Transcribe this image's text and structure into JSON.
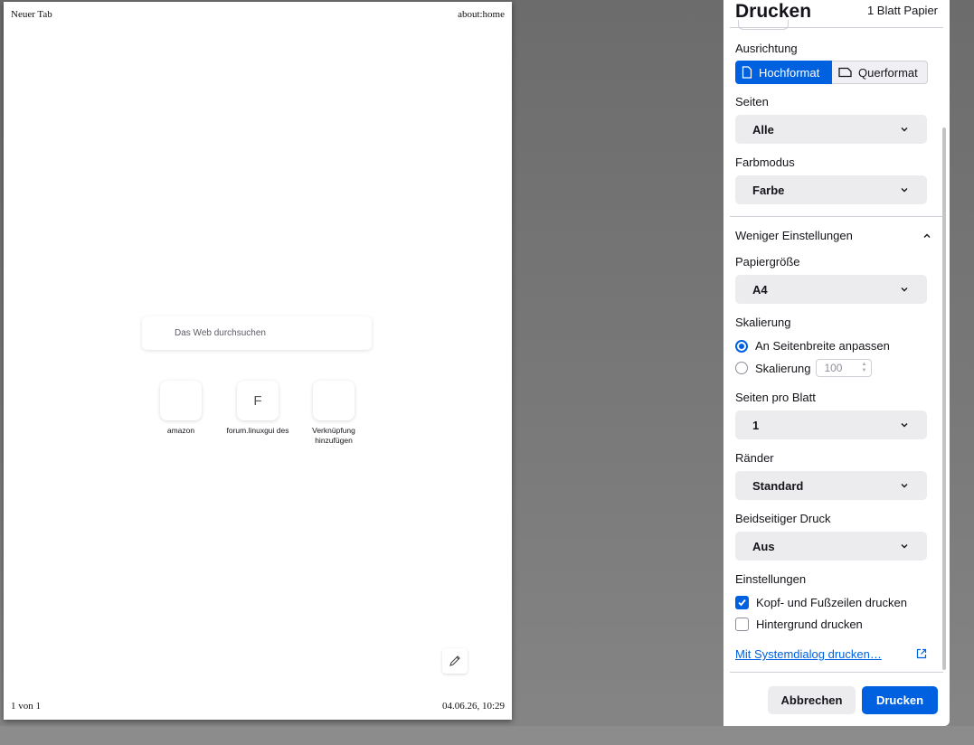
{
  "preview": {
    "header_left": "Neuer Tab",
    "header_right": "about:home",
    "footer_left": "1 von 1",
    "footer_right": "04.06.26, 10:29",
    "search_placeholder": "Das Web durchsuchen",
    "tiles": [
      {
        "label": "amazon",
        "letter": ""
      },
      {
        "label": "forum.linuxgui des",
        "letter": "F"
      },
      {
        "label": "Verknüpfung hinzufügen",
        "letter": ""
      }
    ]
  },
  "panel": {
    "title": "Drucken",
    "sheet_count": "1 Blatt Papier",
    "orientation": {
      "label": "Ausrichtung",
      "portrait": "Hochformat",
      "landscape": "Querformat",
      "selected": "Hochformat"
    },
    "pages": {
      "label": "Seiten",
      "value": "Alle"
    },
    "color_mode": {
      "label": "Farbmodus",
      "value": "Farbe"
    },
    "less_settings": "Weniger Einstellungen",
    "paper_size": {
      "label": "Papiergröße",
      "value": "A4"
    },
    "scaling": {
      "label": "Skalierung",
      "fit_width": "An Seitenbreite anpassen",
      "custom": "Skalierung",
      "custom_value": "100",
      "selected": "An Seitenbreite anpassen"
    },
    "pages_per_sheet": {
      "label": "Seiten pro Blatt",
      "value": "1"
    },
    "margins": {
      "label": "Ränder",
      "value": "Standard"
    },
    "duplex": {
      "label": "Beidseitiger Druck",
      "value": "Aus"
    },
    "options": {
      "label": "Einstellungen",
      "headers_footers": "Kopf- und Fußzeilen drucken",
      "headers_footers_checked": true,
      "background": "Hintergrund drucken",
      "background_checked": false
    },
    "system_dialog_link": "Mit Systemdialog drucken…",
    "cancel_label": "Abbrechen",
    "print_label": "Drucken"
  },
  "colors": {
    "accent": "#0061e0",
    "select_bg": "#ececee",
    "backdrop": "#6c6c6c"
  }
}
